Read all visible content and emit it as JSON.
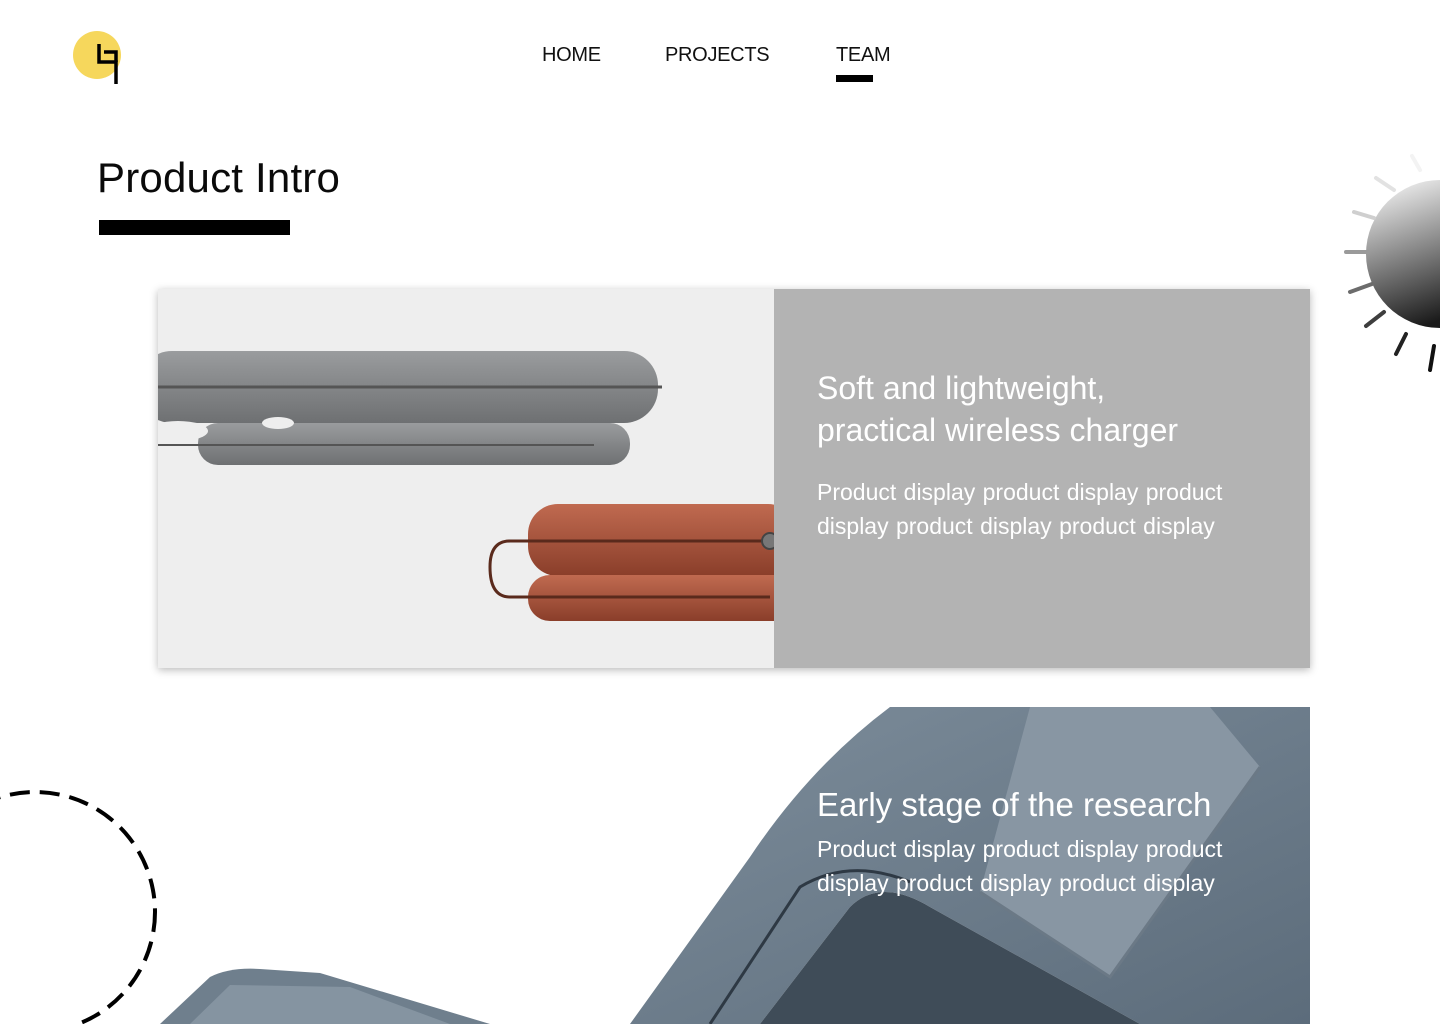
{
  "brand": {
    "logo_icon": "yellow-circle-logo",
    "accent_color": "#f6d75c"
  },
  "nav": {
    "items": [
      {
        "label": "HOME"
      },
      {
        "label": "PROJECTS"
      },
      {
        "label": "TEAM"
      }
    ],
    "active": "TEAM"
  },
  "intro": {
    "title": "Product Intro"
  },
  "card": {
    "title_line1": "Soft and lightweight,",
    "title_line2": "practical wireless charger",
    "description": "Product display product display  product display  product display  product display"
  },
  "research": {
    "title": "Early stage of the research",
    "description": "Product display product display  product display  product display  product display"
  }
}
